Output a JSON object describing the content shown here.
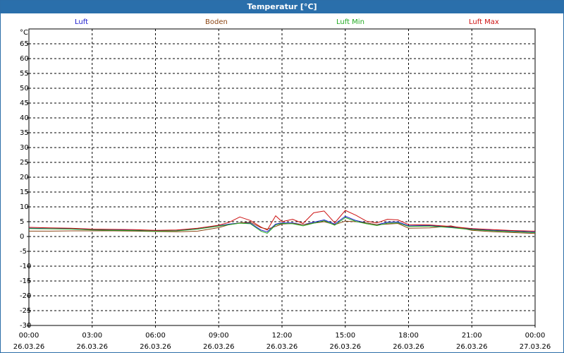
{
  "window": {
    "title": "Temperatur [°C]"
  },
  "chart_data": {
    "type": "line",
    "yunit": "°C",
    "ylim": [
      -30,
      70
    ],
    "yticks": [
      65,
      60,
      55,
      50,
      45,
      40,
      35,
      30,
      25,
      20,
      15,
      10,
      5,
      0,
      -5,
      -10,
      -15,
      -20,
      -25,
      -30
    ],
    "xlim": [
      "2026-03-26T00:00",
      "2026-03-27T00:00"
    ],
    "xticks": [
      {
        "time": "00:00",
        "date": "26.03.26"
      },
      {
        "time": "03:00",
        "date": "26.03.26"
      },
      {
        "time": "06:00",
        "date": "26.03.26"
      },
      {
        "time": "09:00",
        "date": "26.03.26"
      },
      {
        "time": "12:00",
        "date": "26.03.26"
      },
      {
        "time": "15:00",
        "date": "26.03.26"
      },
      {
        "time": "18:00",
        "date": "26.03.26"
      },
      {
        "time": "21:00",
        "date": "26.03.26"
      },
      {
        "time": "00:00",
        "date": "27.03.26"
      }
    ],
    "grid": true,
    "legend_position": "top",
    "series": [
      {
        "name": "Luft",
        "color": "#1a1acc",
        "x": [
          0,
          1,
          2,
          3,
          4,
          5,
          6,
          7,
          8,
          9,
          9.5,
          10,
          10.5,
          11,
          11.3,
          11.7,
          12,
          12.5,
          13,
          13.5,
          14,
          14.5,
          15,
          15.5,
          16,
          16.5,
          17,
          17.5,
          18,
          19,
          20,
          21,
          22,
          23,
          24
        ],
        "y": [
          2.8,
          2.7,
          2.6,
          2.3,
          2.2,
          2.1,
          1.9,
          2.0,
          2.6,
          3.6,
          4.2,
          4.6,
          4.5,
          2.2,
          1.6,
          4.2,
          4.6,
          4.6,
          4.0,
          4.8,
          5.6,
          4.2,
          6.8,
          5.4,
          4.6,
          4.0,
          4.8,
          4.9,
          3.6,
          3.7,
          3.2,
          2.5,
          2.1,
          1.8,
          1.5
        ]
      },
      {
        "name": "Boden",
        "color": "#8b4513",
        "x": [
          0,
          1,
          2,
          3,
          4,
          5,
          6,
          7,
          8,
          9,
          9.5,
          10,
          10.5,
          11,
          11.3,
          11.7,
          12,
          12.5,
          13,
          13.5,
          14,
          14.5,
          15,
          15.5,
          16,
          16.5,
          17,
          17.5,
          18,
          19,
          20,
          21,
          22,
          23,
          24
        ],
        "y": [
          1.8,
          1.8,
          1.9,
          1.9,
          1.9,
          1.8,
          1.7,
          1.6,
          1.8,
          3.0,
          4.0,
          4.6,
          4.8,
          3.0,
          2.5,
          3.4,
          4.2,
          4.4,
          4.0,
          4.5,
          5.0,
          4.0,
          5.2,
          5.0,
          4.6,
          4.0,
          4.2,
          4.4,
          2.8,
          2.9,
          3.6,
          2.1,
          1.6,
          1.3,
          1.0
        ]
      },
      {
        "name": "Luft Min",
        "color": "#22aa22",
        "x": [
          0,
          1,
          2,
          3,
          4,
          5,
          6,
          7,
          8,
          9,
          9.5,
          10,
          10.5,
          11,
          11.3,
          11.7,
          12,
          12.5,
          13,
          13.5,
          14,
          14.5,
          15,
          15.5,
          16,
          16.5,
          17,
          17.5,
          18,
          19,
          20,
          21,
          22,
          23,
          24
        ],
        "y": [
          2.7,
          2.6,
          2.5,
          2.2,
          2.1,
          2.0,
          1.8,
          1.9,
          2.5,
          3.5,
          4.0,
          4.5,
          4.3,
          1.8,
          1.1,
          3.9,
          4.4,
          4.3,
          3.6,
          4.5,
          5.3,
          3.8,
          6.4,
          5.1,
          4.3,
          3.7,
          4.5,
          4.6,
          3.4,
          3.5,
          3.0,
          2.3,
          1.9,
          1.6,
          1.3
        ]
      },
      {
        "name": "Luft Max",
        "color": "#cc1111",
        "x": [
          0,
          1,
          2,
          3,
          4,
          5,
          6,
          7,
          8,
          9,
          9.5,
          10,
          10.5,
          11,
          11.3,
          11.7,
          12,
          12.5,
          13,
          13.5,
          14,
          14.5,
          15,
          15.5,
          16,
          16.5,
          17,
          17.5,
          18,
          19,
          20,
          21,
          22,
          23,
          24
        ],
        "y": [
          3.1,
          2.9,
          2.8,
          2.5,
          2.4,
          2.3,
          2.1,
          2.2,
          2.8,
          3.8,
          4.8,
          6.6,
          5.4,
          3.2,
          2.2,
          7.0,
          5.0,
          5.8,
          4.4,
          8.0,
          8.6,
          4.6,
          8.8,
          7.2,
          5.2,
          4.6,
          5.8,
          5.6,
          4.0,
          3.9,
          3.4,
          2.7,
          2.3,
          2.0,
          1.8
        ]
      }
    ]
  }
}
